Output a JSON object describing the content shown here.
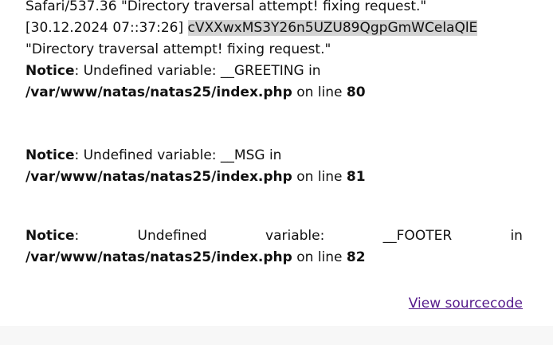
{
  "log": {
    "line1": "Safari/537.36 \"Directory traversal attempt! fixing request.\"",
    "line2_date": "[30.12.2024 07::37:26]",
    "line2_session": "cVXXwxMS3Y26n5UZU89QgpGmWCelaQlE",
    "line3": "\"Directory traversal attempt! fixing request.\""
  },
  "notices": [
    {
      "label": "Notice",
      "message": ": Undefined variable: __GREETING in",
      "path": "/var/www/natas/natas25/index.php",
      "on_line": "on line",
      "line_no": "80"
    },
    {
      "label": "Notice",
      "message": ": Undefined variable: __MSG in",
      "path": "/var/www/natas/natas25/index.php",
      "on_line": "on line",
      "line_no": "81"
    },
    {
      "label": "Notice",
      "message_parts": [
        ":",
        "Undefined",
        "variable:",
        "__FOOTER",
        "in"
      ],
      "path": "/var/www/natas/natas25/index.php",
      "on_line": "on line",
      "line_no": "82"
    }
  ],
  "view_source": "View sourcecode"
}
